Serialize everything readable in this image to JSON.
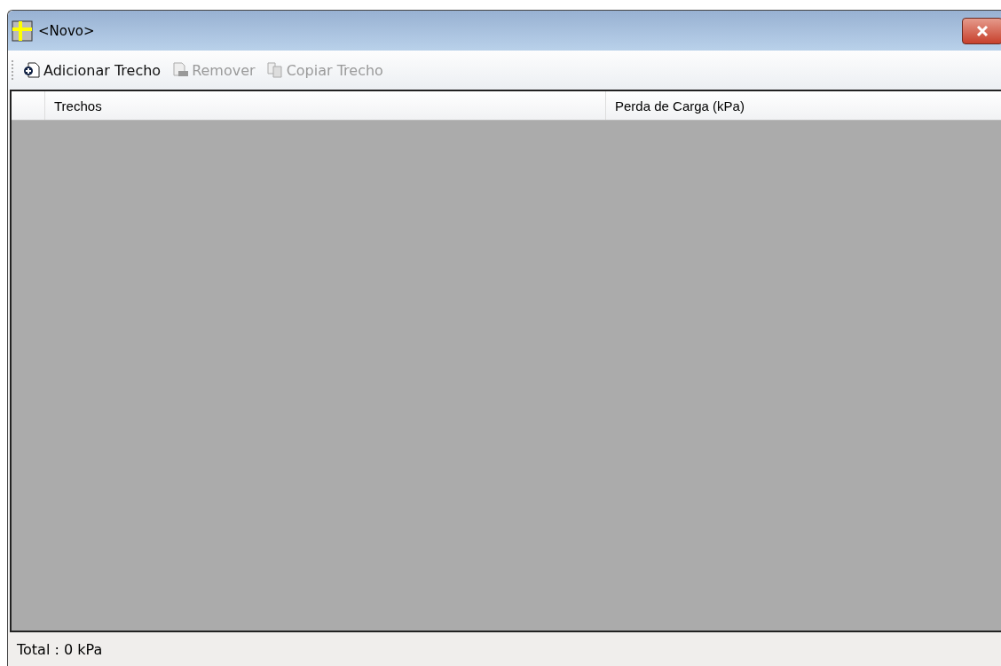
{
  "window": {
    "title": "<Novo>"
  },
  "toolbar": [
    {
      "label": "Adicionar Trecho",
      "kind": "add",
      "disabled": false
    },
    {
      "label": "Remover",
      "kind": "remove",
      "disabled": true
    },
    {
      "label": "Copiar Trecho",
      "kind": "copy",
      "disabled": true
    }
  ],
  "table": {
    "columns": [
      "Trechos",
      "Perda de Carga (kPa)"
    ]
  },
  "status_bar": "Total : 0 kPa"
}
